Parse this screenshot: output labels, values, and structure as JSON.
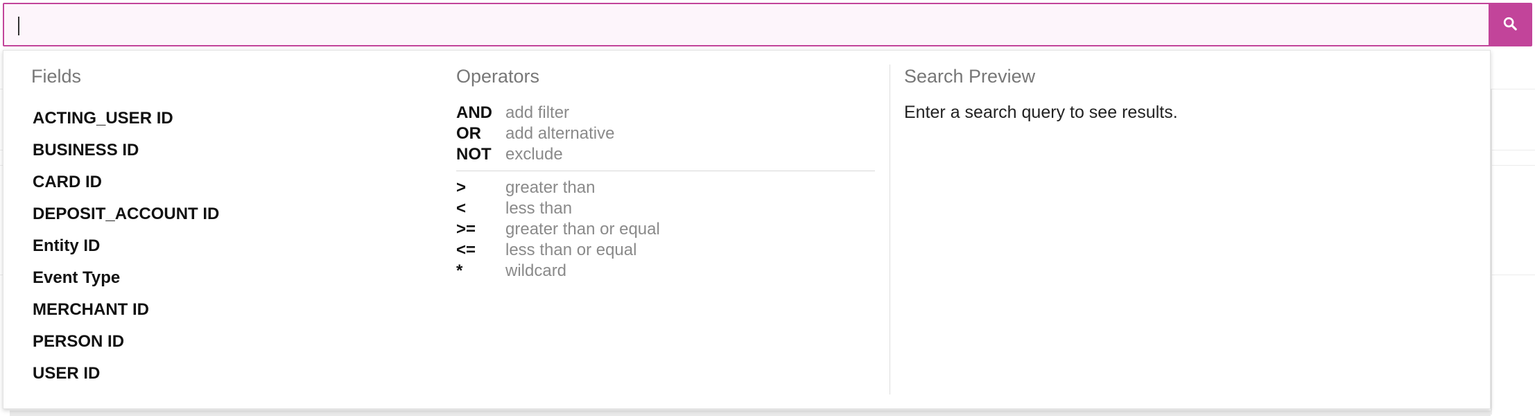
{
  "search": {
    "value": "",
    "placeholder": "",
    "button_icon": "search-icon",
    "accent_color": "#c2449a"
  },
  "fields": {
    "heading": "Fields",
    "items": [
      "ACTING_USER ID",
      "BUSINESS ID",
      "CARD ID",
      "DEPOSIT_ACCOUNT ID",
      "Entity ID",
      "Event Type",
      "MERCHANT ID",
      "PERSON ID",
      "USER ID"
    ]
  },
  "operators": {
    "heading": "Operators",
    "logical": [
      {
        "symbol": "AND",
        "description": "add filter"
      },
      {
        "symbol": "OR",
        "description": "add alternative"
      },
      {
        "symbol": "NOT",
        "description": "exclude"
      }
    ],
    "comparison": [
      {
        "symbol": ">",
        "description": "greater than"
      },
      {
        "symbol": "<",
        "description": "less than"
      },
      {
        "symbol": ">=",
        "description": "greater than or equal"
      },
      {
        "symbol": "<=",
        "description": "less than or equal"
      },
      {
        "symbol": "*",
        "description": "wildcard"
      }
    ]
  },
  "preview": {
    "heading": "Search Preview",
    "message": "Enter a search query to see results."
  }
}
